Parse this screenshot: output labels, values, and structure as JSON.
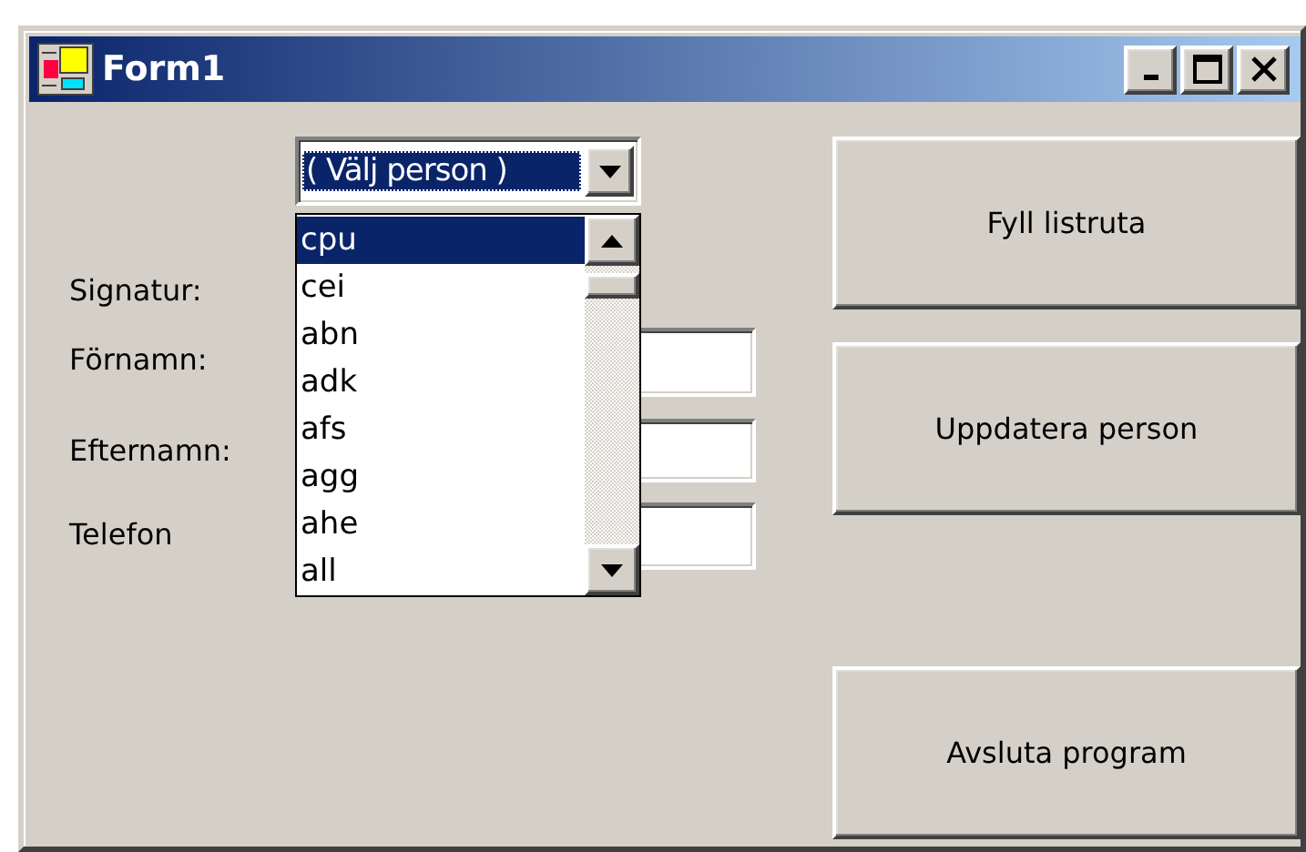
{
  "window": {
    "title": "Form1"
  },
  "person_combo": {
    "value": "( Välj person )",
    "text_selected": true,
    "expanded": true,
    "options": [
      {
        "label": "cpu",
        "selected": true
      },
      {
        "label": "cei",
        "selected": false
      },
      {
        "label": "abn",
        "selected": false
      },
      {
        "label": "adk",
        "selected": false
      },
      {
        "label": "afs",
        "selected": false
      },
      {
        "label": "agg",
        "selected": false
      },
      {
        "label": "ahe",
        "selected": false
      },
      {
        "label": "all",
        "selected": false
      }
    ]
  },
  "fields": [
    {
      "label": "Signatur:",
      "kind": "label"
    },
    {
      "label": "Förnamn:",
      "kind": "text-field"
    },
    {
      "label": "Efternamn:",
      "kind": "text-field"
    },
    {
      "label": "Telefon",
      "kind": "text-field"
    }
  ],
  "button_groups": [
    [
      "Fyll listruta",
      "Uppdatera person"
    ],
    [
      "Avsluta program"
    ]
  ]
}
